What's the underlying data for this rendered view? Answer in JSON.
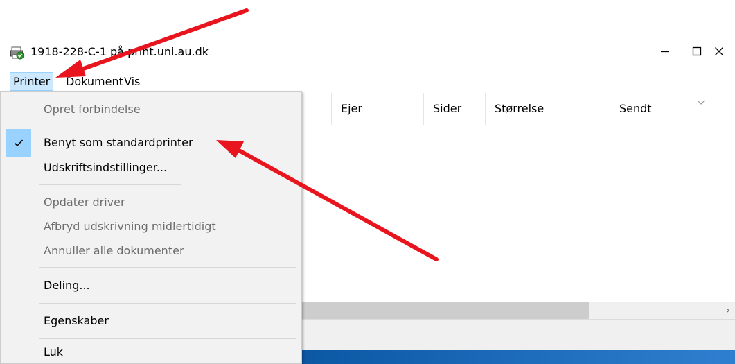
{
  "window": {
    "title": "1918-228-C-1 på print.uni.au.dk",
    "icon": "printer-queue-icon",
    "controls": [
      "minimize-icon",
      "maximize-icon",
      "close-icon"
    ]
  },
  "menubar": {
    "items": [
      {
        "label": "Printer",
        "active": true
      },
      {
        "label": "Dokument",
        "active": false
      },
      {
        "label": "Vis",
        "active": false
      }
    ]
  },
  "columns": [
    "Ejer",
    "Sider",
    "Størrelse",
    "Sendt"
  ],
  "dropdown": {
    "items": [
      {
        "label": "Opret forbindelse",
        "enabled": false,
        "checked": false
      },
      {
        "label": "Benyt som standardprinter",
        "enabled": true,
        "checked": true
      },
      {
        "label": "Udskriftsindstillinger...",
        "enabled": true,
        "checked": false
      },
      {
        "label": "Opdater driver",
        "enabled": false,
        "checked": false
      },
      {
        "label": "Afbryd udskrivning midlertidigt",
        "enabled": false,
        "checked": false
      },
      {
        "label": "Annuller alle dokumenter",
        "enabled": false,
        "checked": false
      },
      {
        "label": "Deling...",
        "enabled": true,
        "checked": false
      },
      {
        "label": "Egenskaber",
        "enabled": true,
        "checked": false
      },
      {
        "label": "Luk",
        "enabled": true,
        "checked": false
      }
    ]
  },
  "colors": {
    "menu_highlight": "#cce8ff",
    "check_highlight": "#99d1ff",
    "annotation_arrow": "#e8141e",
    "taskbar": "#0d5aa7"
  }
}
